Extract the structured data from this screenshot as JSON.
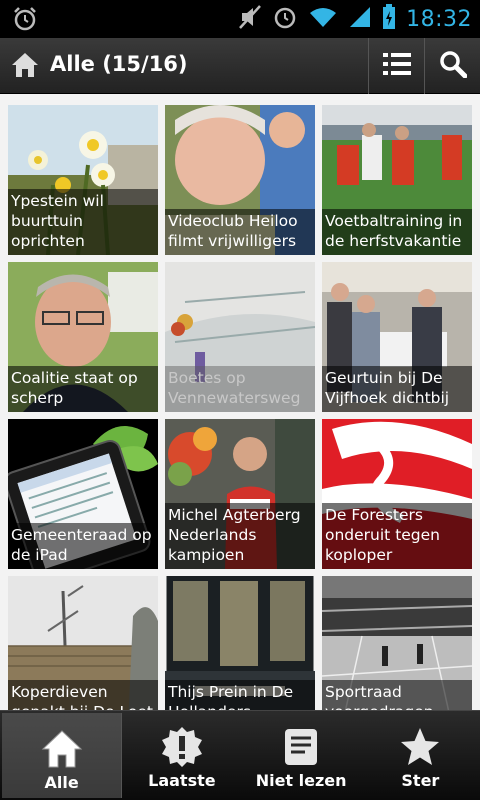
{
  "status": {
    "time": "18:32",
    "icons": [
      "alarm-icon",
      "mute-icon",
      "alarm-clock-icon",
      "wifi-icon",
      "signal-icon",
      "battery-charging-icon"
    ]
  },
  "actionbar": {
    "title": "Alle (15/16)",
    "icons": [
      "home-icon",
      "list-icon",
      "search-icon"
    ]
  },
  "tiles": [
    {
      "caption": "Ypestein wil buurttuin oprichten",
      "read": false
    },
    {
      "caption": "Videoclub Heiloo filmt vrijwilligers",
      "read": false
    },
    {
      "caption": "Voetbaltraining in de herfstvakantie",
      "read": false
    },
    {
      "caption": "Coalitie staat op scherp",
      "read": false
    },
    {
      "caption": "Boetes op Vennewatersweg",
      "read": true
    },
    {
      "caption": "Geurtuin bij De Vijfhoek dichtbij",
      "read": false
    },
    {
      "caption": "Gemeenteraad op de iPad",
      "read": false
    },
    {
      "caption": "Michel Agterberg Nederlands kampioen",
      "read": false
    },
    {
      "caption": "De Foresters onderuit tegen koploper",
      "read": false
    },
    {
      "caption": "Koperdieven gepakt bij De Loet",
      "read": false
    },
    {
      "caption": "Thijs Prein in De Hollanders",
      "read": false
    },
    {
      "caption": "Sportraad voorgedragen",
      "read": false
    }
  ],
  "bottomnav": {
    "items": [
      {
        "label": "Alle",
        "icon": "home-icon",
        "active": true
      },
      {
        "label": "Laatste",
        "icon": "alert-icon",
        "active": false
      },
      {
        "label": "Niet lezen",
        "icon": "unread-icon",
        "active": false
      },
      {
        "label": "Ster",
        "icon": "star-icon",
        "active": false
      }
    ]
  },
  "colors": {
    "accent": "#33b5e5",
    "actionbar": "#2a2a2a",
    "grid_bg": "#f3f3f3"
  }
}
